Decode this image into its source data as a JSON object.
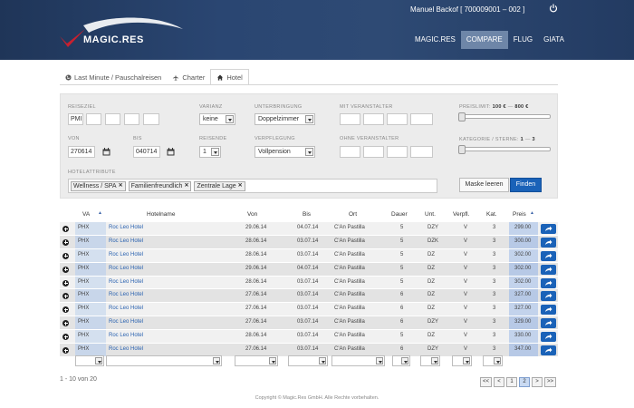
{
  "header": {
    "logo_text": "MAGIC.RES",
    "user": "Manuel Backof [ 700009001 – 002 ]",
    "nav": [
      "MAGIC.RES",
      "COMPARE",
      "FLUG",
      "GIATA"
    ],
    "nav_active": 1
  },
  "tabs": [
    {
      "icon": "globe-icon",
      "label": "Last Minute / Pauschalreisen"
    },
    {
      "icon": "plane-icon",
      "label": "Charter"
    },
    {
      "icon": "home-icon",
      "label": "Hotel"
    }
  ],
  "tab_active": 2,
  "filters": {
    "reiseziel_label": "REISEZIEL",
    "reiseziel_value": "PMI",
    "varianz_label": "VARIANZ",
    "varianz_value": "keine",
    "unterbringung_label": "UNTERBRINGUNG",
    "unterbringung_value": "Doppelzimmer",
    "mit_veranstalter_label": "MIT VERANSTALTER",
    "preislimit_label": "PREISLIMIT:",
    "preislimit_min": "100 €",
    "preislimit_sep": "—",
    "preislimit_max": "800 €",
    "von_label": "VON",
    "von_value": "270614",
    "bis_label": "BIS",
    "bis_value": "040714",
    "reisende_label": "REISENDE",
    "reisende_value": "1",
    "verpflegung_label": "VERPFLEGUNG",
    "verpflegung_value": "Vollpension",
    "ohne_veranstalter_label": "OHNE VERANSTALTER",
    "kategorie_label": "KATEGORIE / STERNE:",
    "kategorie_min": "1",
    "kategorie_sep": "—",
    "kategorie_max": "3",
    "hotelattribute_label": "HOTELATTRIBUTE",
    "tags": [
      "Wellness / SPA",
      "Familienfreundlich",
      "Zentrale Lage"
    ],
    "clear_button": "Maske leeren",
    "find_button": "Finden"
  },
  "table": {
    "headers": {
      "va": "VA",
      "hotelname": "Hotelname",
      "von": "Von",
      "bis": "Bis",
      "ort": "Ort",
      "dauer": "Dauer",
      "unt": "Unt.",
      "verpfl": "Verpfl.",
      "kat": "Kat.",
      "preis": "Preis"
    },
    "sort_marker": "▲",
    "rows": [
      {
        "va": "PHX",
        "hotel": "Roc Leo Hotel",
        "von": "29.06.14",
        "bis": "04.07.14",
        "ort": "C'An Pastilla",
        "dauer": "5",
        "unt": "DZY",
        "verpfl": "V",
        "kat": "3",
        "preis": "299.00"
      },
      {
        "va": "PHX",
        "hotel": "Roc Leo Hotel",
        "von": "28.06.14",
        "bis": "03.07.14",
        "ort": "C'An Pastilla",
        "dauer": "5",
        "unt": "DZK",
        "verpfl": "V",
        "kat": "3",
        "preis": "300.00"
      },
      {
        "va": "PHX",
        "hotel": "Roc Leo Hotel",
        "von": "28.06.14",
        "bis": "03.07.14",
        "ort": "C'An Pastilla",
        "dauer": "5",
        "unt": "DZ",
        "verpfl": "V",
        "kat": "3",
        "preis": "302.00"
      },
      {
        "va": "PHX",
        "hotel": "Roc Leo Hotel",
        "von": "29.06.14",
        "bis": "04.07.14",
        "ort": "C'An Pastilla",
        "dauer": "5",
        "unt": "DZ",
        "verpfl": "V",
        "kat": "3",
        "preis": "302.00"
      },
      {
        "va": "PHX",
        "hotel": "Roc Leo Hotel",
        "von": "28.06.14",
        "bis": "03.07.14",
        "ort": "C'An Pastilla",
        "dauer": "5",
        "unt": "DZ",
        "verpfl": "V",
        "kat": "3",
        "preis": "302.00"
      },
      {
        "va": "PHX",
        "hotel": "Roc Leo Hotel",
        "von": "27.06.14",
        "bis": "03.07.14",
        "ort": "C'An Pastilla",
        "dauer": "6",
        "unt": "DZ",
        "verpfl": "V",
        "kat": "3",
        "preis": "327.00"
      },
      {
        "va": "PHX",
        "hotel": "Roc Leo Hotel",
        "von": "27.06.14",
        "bis": "03.07.14",
        "ort": "C'An Pastilla",
        "dauer": "6",
        "unt": "DZ",
        "verpfl": "V",
        "kat": "3",
        "preis": "327.00"
      },
      {
        "va": "PHX",
        "hotel": "Roc Leo Hotel",
        "von": "27.06.14",
        "bis": "03.07.14",
        "ort": "C'An Pastilla",
        "dauer": "6",
        "unt": "DZY",
        "verpfl": "V",
        "kat": "3",
        "preis": "329.00"
      },
      {
        "va": "PHX",
        "hotel": "Roc Leo Hotel",
        "von": "28.06.14",
        "bis": "03.07.14",
        "ort": "C'An Pastilla",
        "dauer": "5",
        "unt": "DZ",
        "verpfl": "V",
        "kat": "3",
        "preis": "330.00"
      },
      {
        "va": "PHX",
        "hotel": "Roc Leo Hotel",
        "von": "27.06.14",
        "bis": "03.07.14",
        "ort": "C'An Pastilla",
        "dauer": "6",
        "unt": "DZY",
        "verpfl": "V",
        "kat": "3",
        "preis": "347.00"
      }
    ]
  },
  "pagination": {
    "count_text": "1 - 10 von 20",
    "buttons": [
      "<<",
      "<",
      "1",
      "2",
      ">",
      ">>"
    ],
    "active_page": "2"
  },
  "footer": "Copyright © Magic.Res GmbH. Alle Rechte vorbehalten.",
  "colors": {
    "header_bg": "#2a4672",
    "accent": "#1a62b8",
    "nav_active": "#6e86a8",
    "logo_check": "#c8202f"
  }
}
